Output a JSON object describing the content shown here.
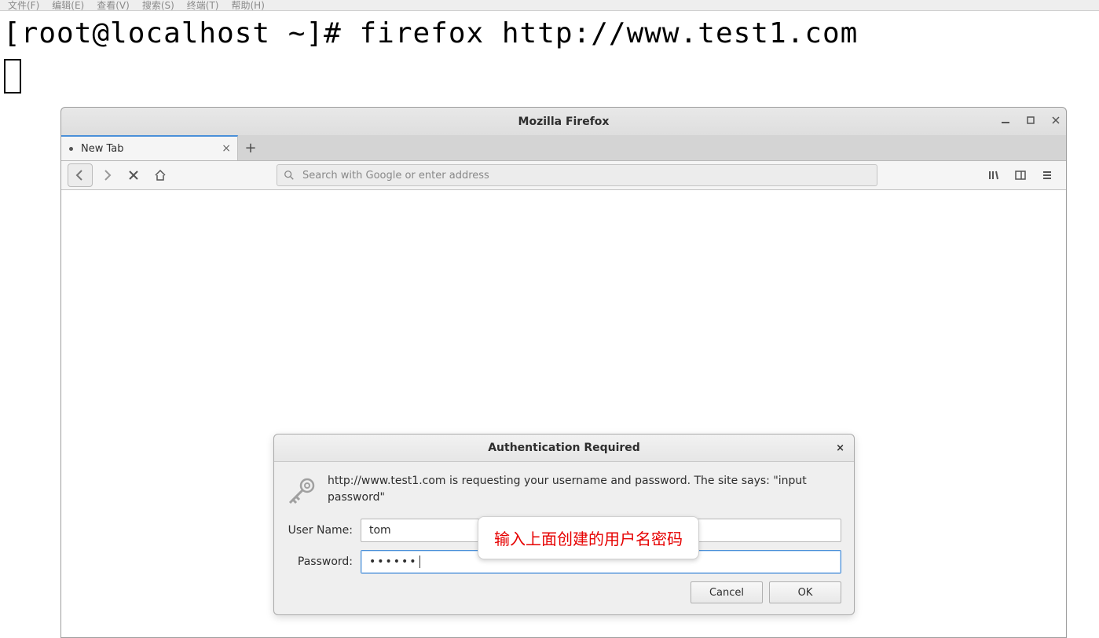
{
  "terminal": {
    "menu": [
      "文件(F)",
      "编辑(E)",
      "查看(V)",
      "搜索(S)",
      "终端(T)",
      "帮助(H)"
    ],
    "line": "[root@localhost ~]# firefox http://www.test1.com"
  },
  "firefox": {
    "title": "Mozilla Firefox",
    "tab_label": "New Tab",
    "url_placeholder": "Search with Google or enter address"
  },
  "auth": {
    "title": "Authentication Required",
    "message": "http://www.test1.com is requesting your username and password. The site says: \"input password\"",
    "username_label": "User Name:",
    "username_value": "tom",
    "password_label": "Password:",
    "password_value": "••••••",
    "cancel": "Cancel",
    "ok": "OK"
  },
  "callout": {
    "text": "输入上面创建的用户名密码"
  }
}
